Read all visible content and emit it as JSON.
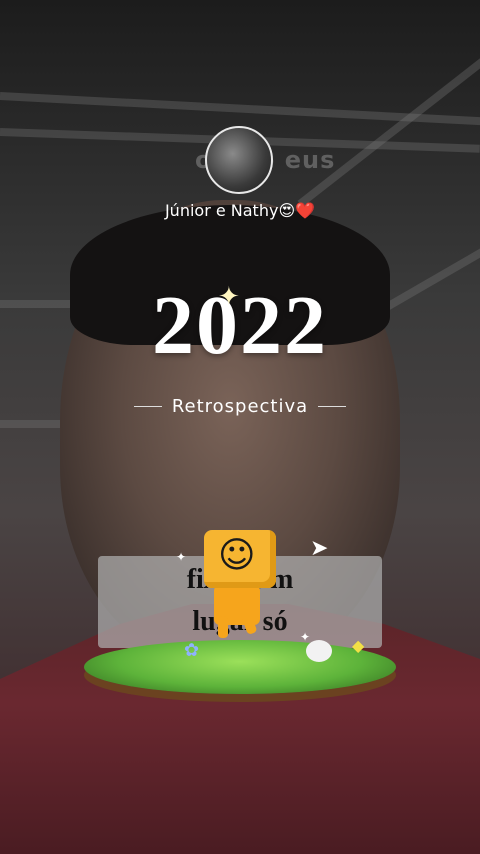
{
  "story": {
    "watermark": "o que eus",
    "username": "Júnior e Nathy😍❤️",
    "year": "2022",
    "subtitle": "Retrospectiva",
    "caption_line1": "fixo num",
    "caption_line2": "lugar só"
  },
  "icons": {
    "sparkle": "✦",
    "mascot_face": "☺",
    "plane": "➤",
    "flower": "✿",
    "flag": "◆",
    "star": "✦"
  },
  "colors": {
    "text": "#ffffff",
    "caption_bg": "#afafaf",
    "mascot": "#f6b531",
    "grass": "#5db33a",
    "shirt": "#5b2428"
  }
}
